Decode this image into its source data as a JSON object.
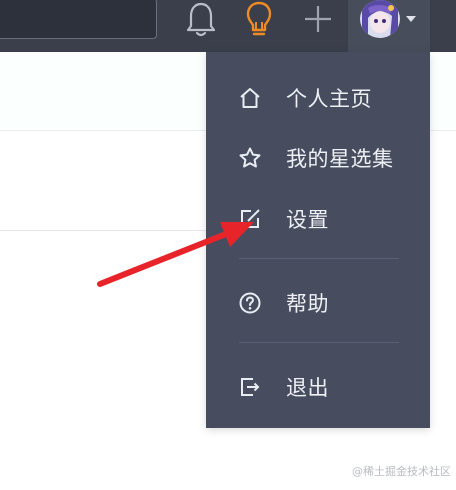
{
  "menu": {
    "items": [
      {
        "label": "个人主页",
        "icon": "home-icon"
      },
      {
        "label": "我的星选集",
        "icon": "star-icon"
      },
      {
        "label": "设置",
        "icon": "edit-icon"
      },
      {
        "label": "帮助",
        "icon": "help-icon"
      },
      {
        "label": "退出",
        "icon": "logout-icon"
      }
    ]
  },
  "topbar": {
    "icons": [
      "bell-icon",
      "lightbulb-icon",
      "plus-icon"
    ],
    "avatar": "avatar",
    "caret": "caret-down-icon"
  },
  "watermark": "@稀土掘金技术社区",
  "colors": {
    "topbar_bg": "#3a3f4b",
    "menu_bg": "#474d5f",
    "menu_text": "#eef0f4",
    "bulb_accent": "#f08a24",
    "arrow": "#e8242b"
  }
}
